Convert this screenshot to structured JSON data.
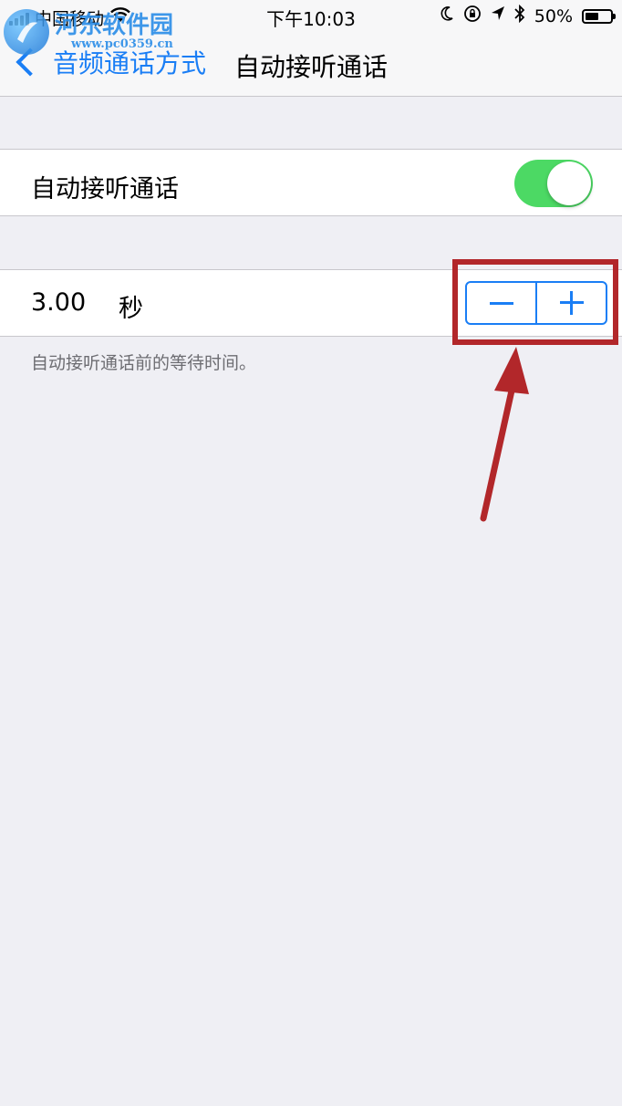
{
  "status_bar": {
    "carrier": "中国移动",
    "time": "下午10:03",
    "battery_percent": "50%",
    "icons": [
      "signal-icon",
      "wifi-icon",
      "moon-icon",
      "rotation-lock-icon",
      "location-icon",
      "bluetooth-icon",
      "battery-icon"
    ]
  },
  "watermark": {
    "name": "河东软件园",
    "url": "www.pc0359.cn"
  },
  "nav": {
    "back_label": "音频通话方式",
    "title": "自动接听通话"
  },
  "auto_answer": {
    "label": "自动接听通话",
    "enabled": true
  },
  "delay": {
    "value": "3.00",
    "unit": "秒",
    "minus_icon": "minus-icon",
    "plus_icon": "plus-icon",
    "footer": "自动接听通话前的等待时间。"
  },
  "colors": {
    "accent": "#1a7ef5",
    "toggle_on": "#4cd964",
    "annotation": "#b2272a",
    "background": "#efeff4"
  }
}
